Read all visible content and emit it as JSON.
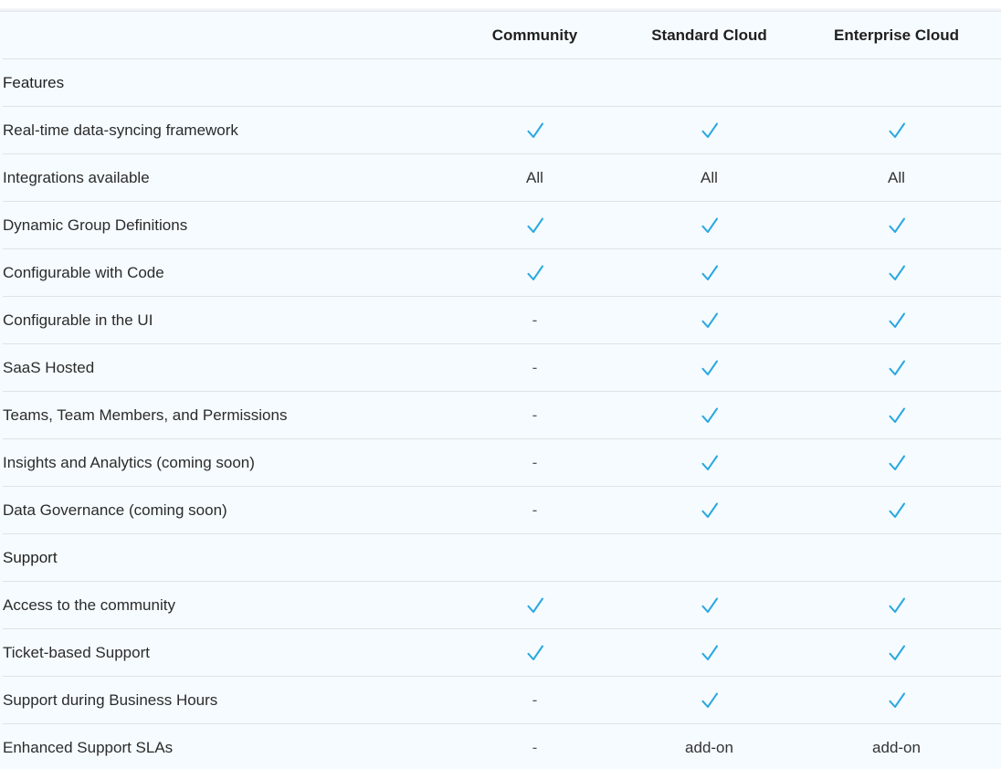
{
  "columns": [
    "Community",
    "Standard Cloud",
    "Enterprise Cloud"
  ],
  "sections": [
    {
      "title": "Features",
      "rows": [
        {
          "label": "Real-time data-syncing framework",
          "values": [
            "check",
            "check",
            "check"
          ]
        },
        {
          "label": "Integrations available",
          "values": [
            "All",
            "All",
            "All"
          ]
        },
        {
          "label": "Dynamic Group Definitions",
          "values": [
            "check",
            "check",
            "check"
          ]
        },
        {
          "label": "Configurable with Code",
          "values": [
            "check",
            "check",
            "check"
          ]
        },
        {
          "label": "Configurable in the UI",
          "values": [
            "-",
            "check",
            "check"
          ]
        },
        {
          "label": "SaaS Hosted",
          "values": [
            "-",
            "check",
            "check"
          ]
        },
        {
          "label": "Teams, Team Members, and Permissions",
          "values": [
            "-",
            "check",
            "check"
          ]
        },
        {
          "label": "Insights and Analytics (coming soon)",
          "values": [
            "-",
            "check",
            "check"
          ]
        },
        {
          "label": "Data Governance (coming soon)",
          "values": [
            "-",
            "check",
            "check"
          ]
        }
      ]
    },
    {
      "title": "Support",
      "rows": [
        {
          "label": "Access to the community",
          "values": [
            "check",
            "check",
            "check"
          ]
        },
        {
          "label": "Ticket-based Support",
          "values": [
            "check",
            "check",
            "check"
          ]
        },
        {
          "label": "Support during Business Hours",
          "values": [
            "-",
            "check",
            "check"
          ]
        },
        {
          "label": "Enhanced Support SLAs",
          "values": [
            "-",
            "add-on",
            "add-on"
          ]
        }
      ]
    }
  ],
  "icons": {
    "check": "check-icon"
  },
  "colors": {
    "check": "#2aa8e0",
    "background": "#f5fbfe",
    "border": "#dfe3e6"
  }
}
